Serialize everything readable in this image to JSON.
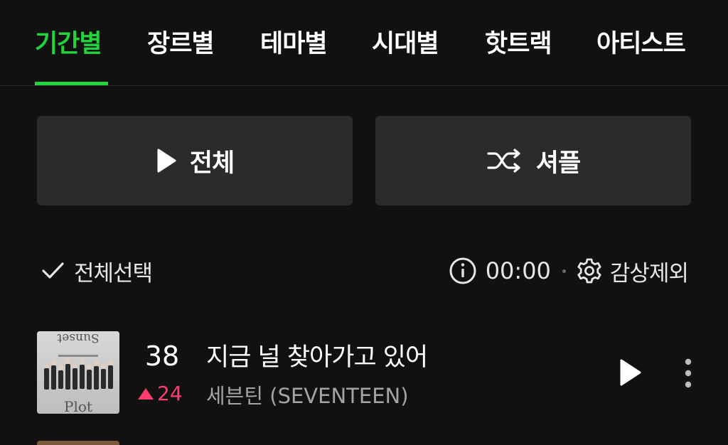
{
  "tabs": [
    {
      "label": "기간별",
      "active": true
    },
    {
      "label": "장르별",
      "active": false
    },
    {
      "label": "테마별",
      "active": false
    },
    {
      "label": "시대별",
      "active": false
    },
    {
      "label": "핫트랙",
      "active": false
    },
    {
      "label": "아티스트",
      "active": false
    }
  ],
  "actions": {
    "play_all": {
      "label": "전체",
      "icon": "play-icon"
    },
    "shuffle": {
      "label": "셔플",
      "icon": "shuffle-icon"
    }
  },
  "list_tools": {
    "select_all": {
      "label": "전체선택",
      "icon": "check-icon"
    },
    "info_icon": "info-icon",
    "time": "00:00",
    "exclude": {
      "label": "감상제외",
      "icon": "gear-icon"
    }
  },
  "tracks": [
    {
      "rank": "38",
      "change_direction": "up",
      "change": "24",
      "title": "지금 널 찾아가고 있어",
      "artist": "세븐틴 (SEVENTEEN)",
      "album_art_text_top": "Sunset",
      "album_art_text_bottom": "Plot"
    }
  ],
  "colors": {
    "accent": "#23d33b",
    "background": "#111111",
    "button_bg": "#2b2b2b",
    "rank_up": "#ff3d6e",
    "secondary_text": "#a4a4a4"
  }
}
